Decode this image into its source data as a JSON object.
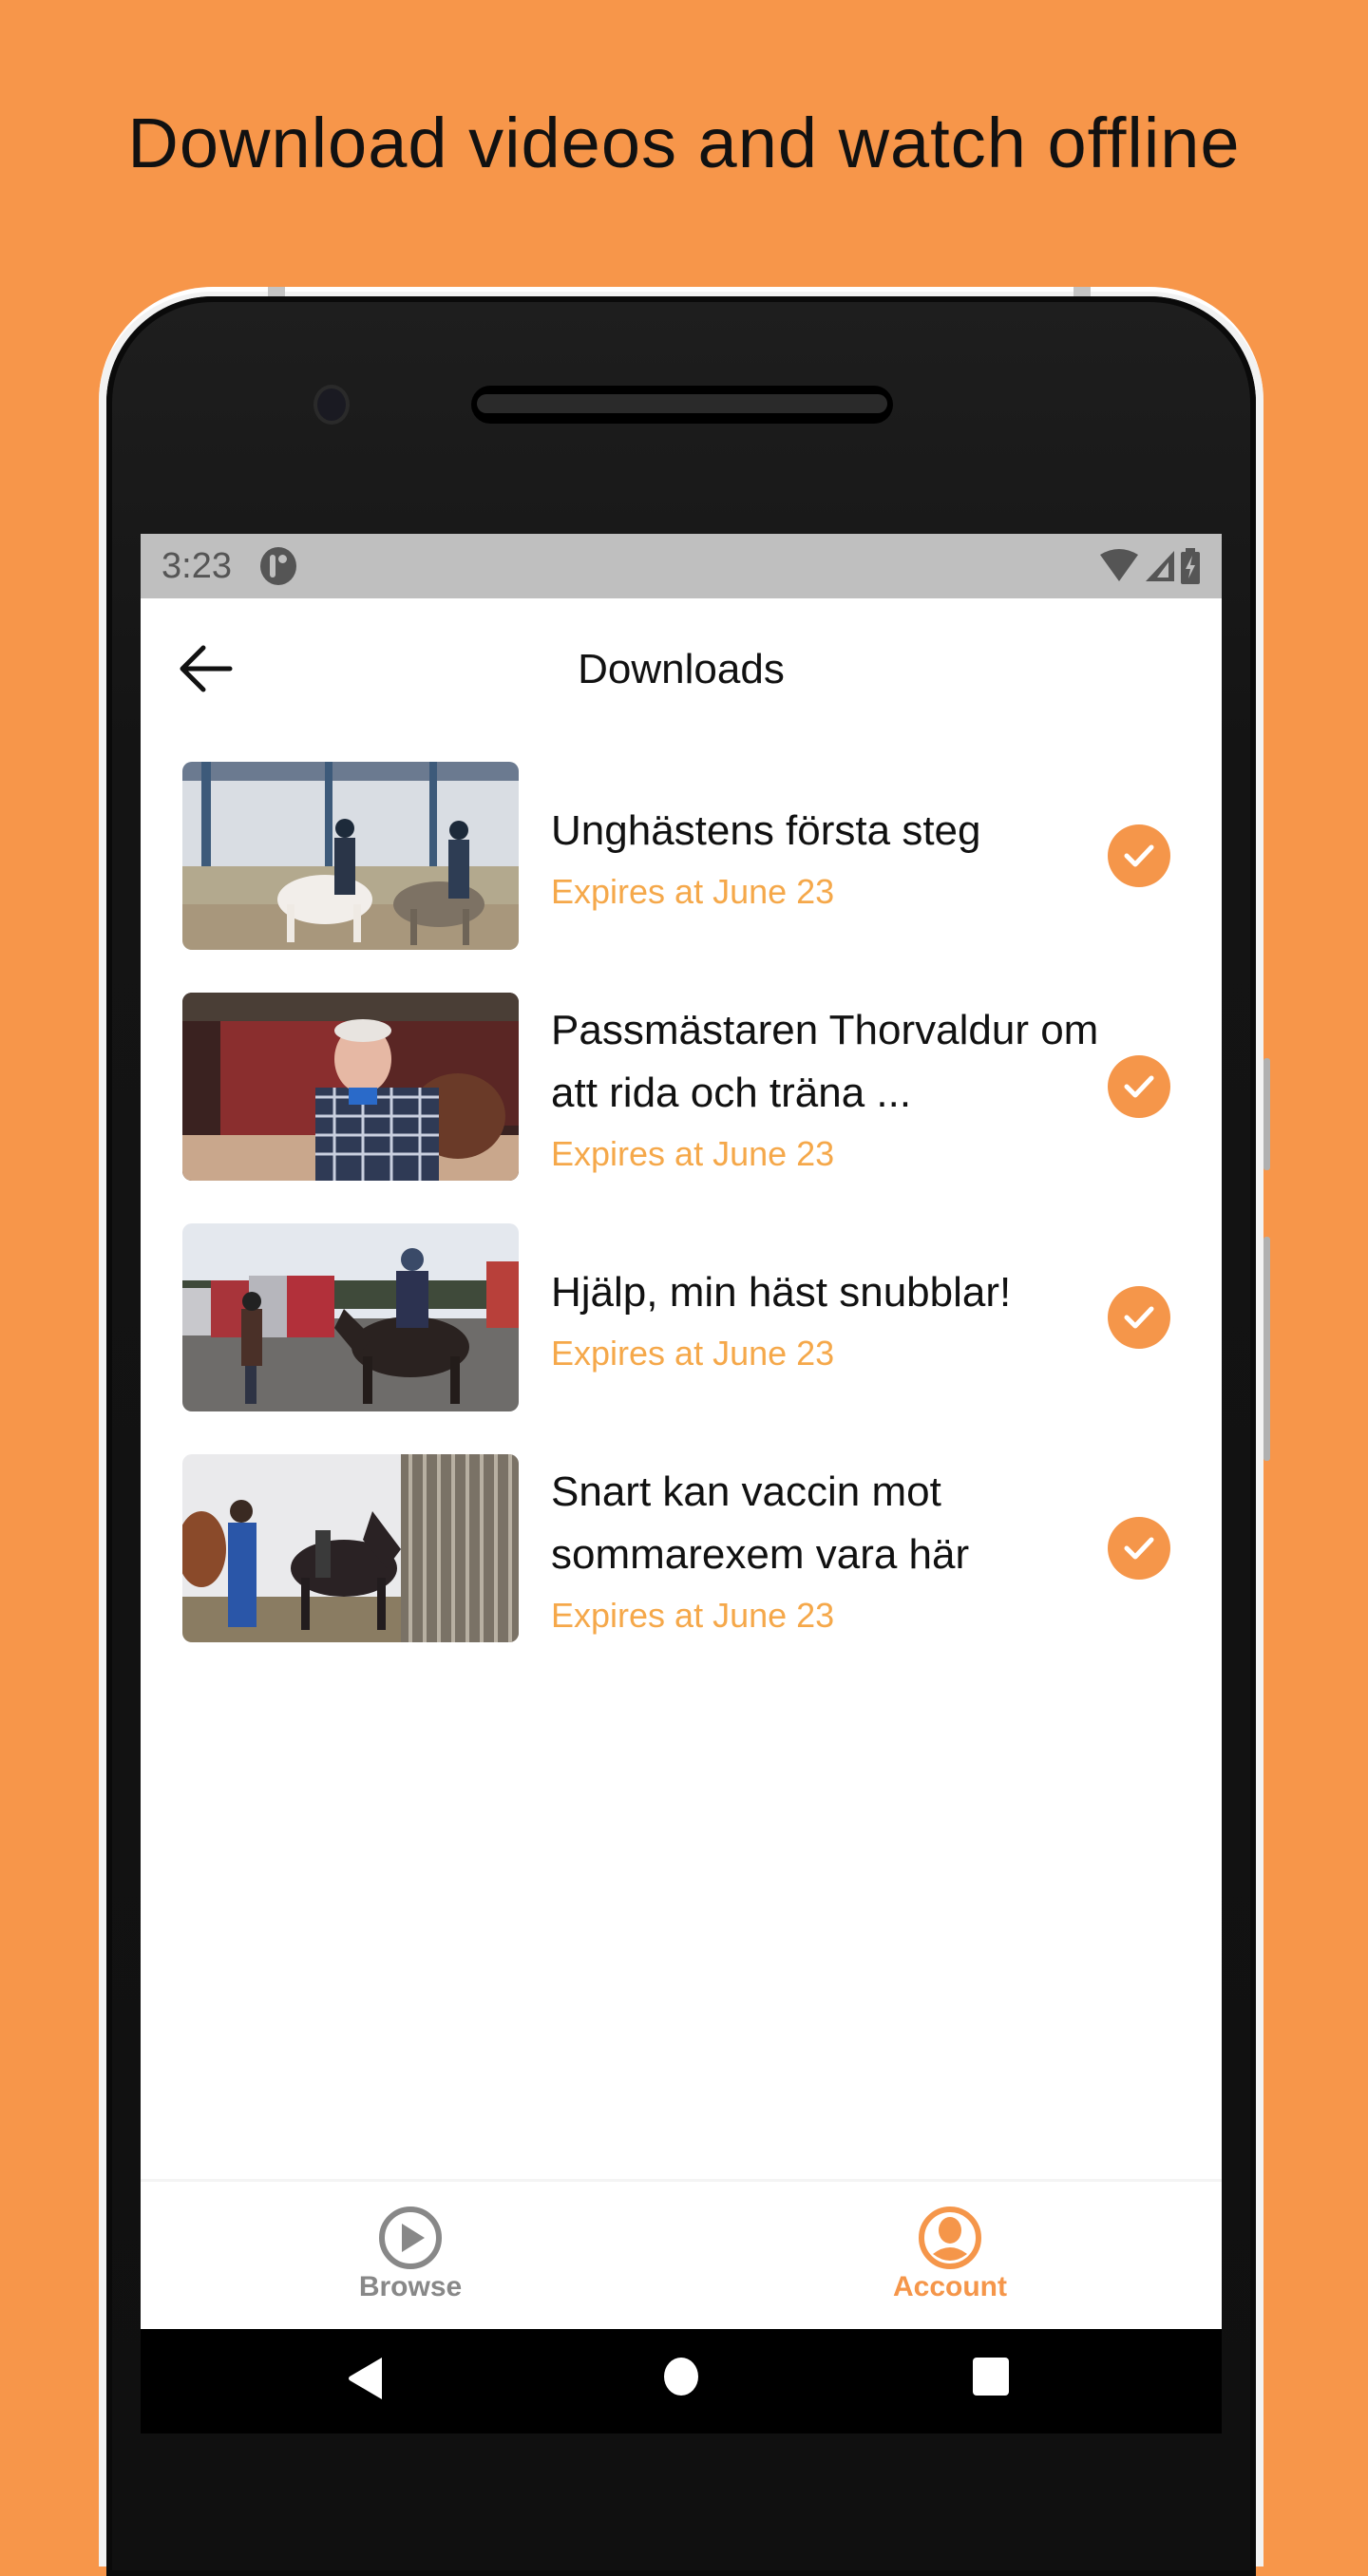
{
  "headline": "Download videos and watch offline",
  "status_bar": {
    "time": "3:23",
    "icons": [
      "app-notification-icon",
      "wifi-icon",
      "signal-icon",
      "battery-charging-icon"
    ]
  },
  "app_bar": {
    "back_icon": "arrow-left-icon",
    "title": "Downloads"
  },
  "downloads": [
    {
      "title": "Unghästens första steg",
      "expiry": "Expires at June 23",
      "thumbnail": "Two riders on horses in indoor arena",
      "status_icon": "check-circle-icon"
    },
    {
      "title": "Passmästaren Thorvaldur om att rida och träna ...",
      "expiry": "Expires at June 23",
      "thumbnail": "Older man in plaid shirt beside horse at stable",
      "status_icon": "check-circle-icon"
    },
    {
      "title": "Hjälp, min häst snubblar!",
      "expiry": "Expires at June 23",
      "thumbnail": "Rider on dark horse with instructor near trailers",
      "status_icon": "check-circle-icon"
    },
    {
      "title": "Snart kan vaccin mot sommarexem vara här",
      "expiry": "Expires at June 23",
      "thumbnail": "Man in blue coverall with horses by trailer",
      "status_icon": "check-circle-icon"
    }
  ],
  "bottom_nav": {
    "items": [
      {
        "label": "Browse",
        "icon": "play-circle-icon",
        "active": false
      },
      {
        "label": "Account",
        "icon": "account-circle-icon",
        "active": true
      }
    ]
  },
  "system_nav": [
    "back-triangle-icon",
    "home-circle-icon",
    "recents-square-icon"
  ],
  "colors": {
    "background": "#F7964A",
    "accent": "#F5964A",
    "expiry_text": "#F5A84A",
    "inactive_nav": "#888888",
    "status_bar": "#BFBFBF"
  }
}
